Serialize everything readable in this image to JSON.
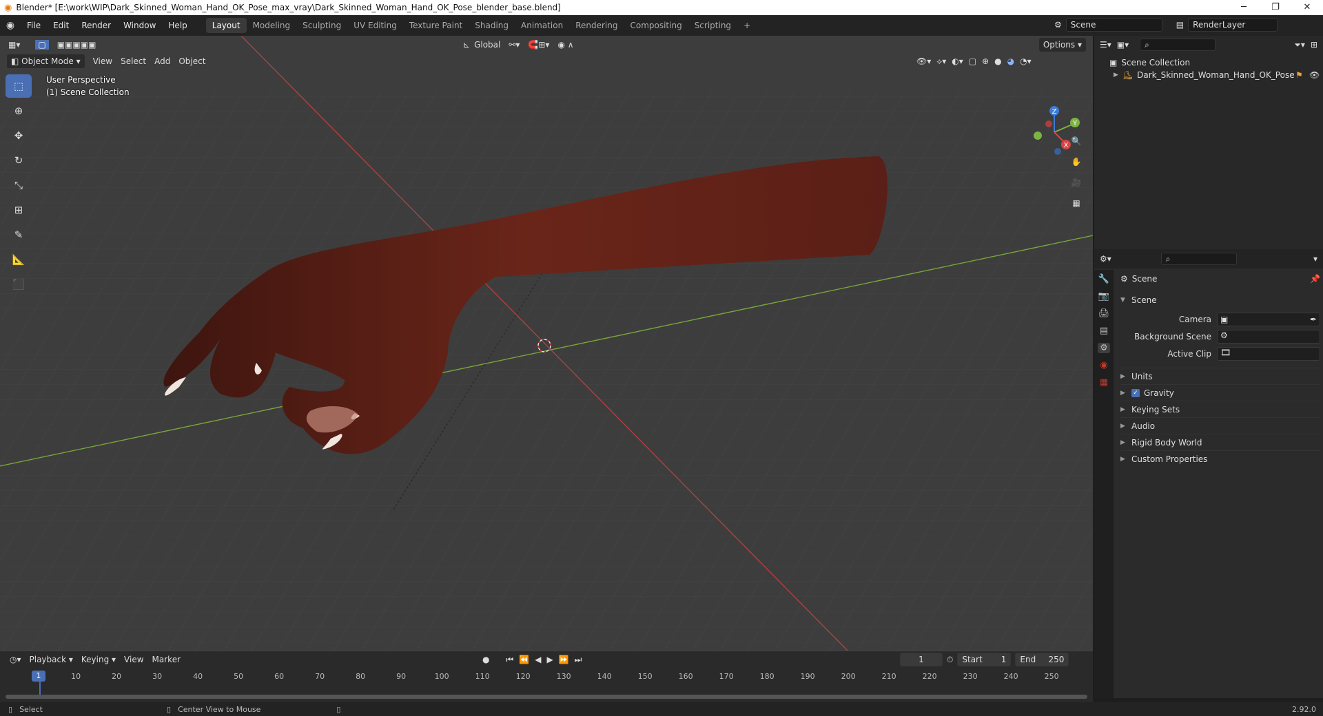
{
  "window": {
    "title": "Blender* [E:\\work\\WIP\\Dark_Skinned_Woman_Hand_OK_Pose_max_vray\\Dark_Skinned_Woman_Hand_OK_Pose_blender_base.blend]",
    "min": "─",
    "max": "❐",
    "close": "✕"
  },
  "menubar": [
    "File",
    "Edit",
    "Render",
    "Window",
    "Help"
  ],
  "workspaces": [
    "Layout",
    "Modeling",
    "Sculpting",
    "UV Editing",
    "Texture Paint",
    "Shading",
    "Animation",
    "Rendering",
    "Compositing",
    "Scripting"
  ],
  "active_workspace": "Layout",
  "add_tab": "+",
  "scene_field": "Scene",
  "renderlayer_field": "RenderLayer",
  "viewport": {
    "mode": "Object Mode",
    "menus": [
      "View",
      "Select",
      "Add",
      "Object"
    ],
    "orientation": "Global",
    "options": "Options",
    "perspective": "User Perspective",
    "collection": "(1) Scene Collection",
    "gizmo": {
      "z": "Z",
      "y": "Y",
      "x": "X"
    }
  },
  "outliner": {
    "root": "Scene Collection",
    "item": "Dark_Skinned_Woman_Hand_OK_Pose"
  },
  "properties": {
    "header": "Scene",
    "section": "Scene",
    "fields": [
      {
        "label": "Camera"
      },
      {
        "label": "Background Scene"
      },
      {
        "label": "Active Clip"
      }
    ],
    "panels": [
      "Units",
      "Gravity",
      "Keying Sets",
      "Audio",
      "Rigid Body World",
      "Custom Properties"
    ],
    "gravity_checked": true
  },
  "timeline": {
    "menus": [
      "Playback",
      "Keying",
      "View",
      "Marker"
    ],
    "current_frame": "1",
    "start_label": "Start",
    "start": "1",
    "end_label": "End",
    "end": "250",
    "ticks": [
      "1",
      "10",
      "20",
      "30",
      "40",
      "50",
      "60",
      "70",
      "80",
      "90",
      "100",
      "110",
      "120",
      "130",
      "140",
      "150",
      "160",
      "170",
      "180",
      "190",
      "200",
      "210",
      "220",
      "230",
      "240",
      "250"
    ]
  },
  "status": {
    "left": "Select",
    "middle": "Center View to Mouse",
    "version": "2.92.0"
  },
  "colors": {
    "accent": "#4a6fb5",
    "x_axis": "#a33a3a",
    "y_axis": "#6e9a2c",
    "skin": "#5e2219"
  }
}
